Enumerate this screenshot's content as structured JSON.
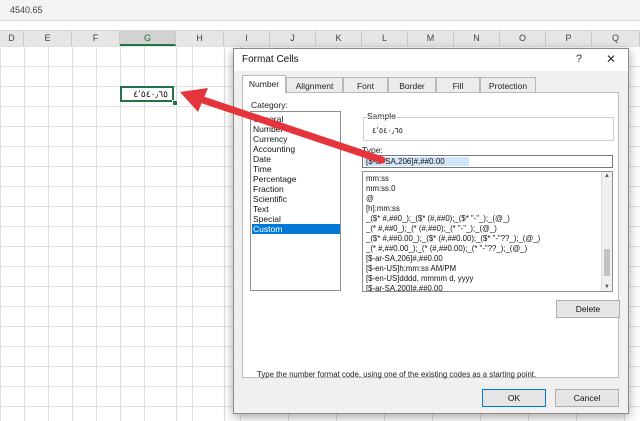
{
  "formula_bar": {
    "value": "4540.65"
  },
  "columns": [
    "D",
    "E",
    "F",
    "G",
    "H",
    "I",
    "J",
    "K",
    "L",
    "M",
    "N",
    "O",
    "P",
    "Q"
  ],
  "active_column": "G",
  "cell": {
    "value": "٤٬٥٤٠٫٦٥"
  },
  "dialog": {
    "title": "Format Cells",
    "help": "?",
    "close": "✕",
    "tabs": [
      "Number",
      "Alignment",
      "Font",
      "Border",
      "Fill",
      "Protection"
    ],
    "category_label": "Category:",
    "categories": [
      "General",
      "Number",
      "Currency",
      "Accounting",
      "Date",
      "Time",
      "Percentage",
      "Fraction",
      "Scientific",
      "Text",
      "Special",
      "Custom"
    ],
    "selected_category": "Custom",
    "sample_label": "Sample",
    "sample_value": "٤٬٥٤٠٫٦٥",
    "type_label": "Type:",
    "type_value": "[$-ar-SA,206]#,##0.00",
    "formats": [
      "mm:ss",
      "mm:ss.0",
      "@",
      "[h]:mm:ss",
      "_($* #,##0_);_($* (#,##0);_($* \"-\"_);_(@_)",
      "_(* #,##0_);_(* (#,##0);_(* \"-\"_);_(@_)",
      "_($* #,##0.00_);_($* (#,##0.00);_($* \"-\"??_);_(@_)",
      "_(* #,##0.00_);_(* (#,##0.00);_(* \"-\"??_);_(@_)",
      "[$-ar-SA,206]#,##0.00",
      "[$-en-US]h:mm:ss AM/PM",
      "[$-en-US]dddd, mmmm d, yyyy",
      "[$-ar-SA,200]#,##0.00"
    ],
    "delete_label": "Delete",
    "hint": "Type the number format code, using one of the existing codes as a starting point.",
    "ok_label": "OK",
    "cancel_label": "Cancel"
  },
  "colors": {
    "accent": "#0078d7",
    "excel_green": "#217346",
    "arrow": "#e5343b"
  }
}
